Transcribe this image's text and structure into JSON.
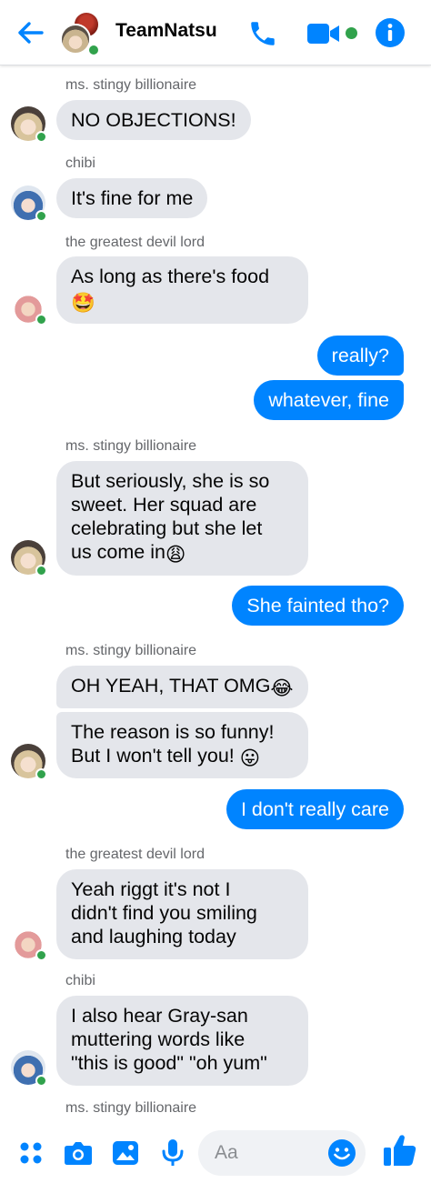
{
  "header": {
    "back_icon": "arrow-left-icon",
    "title": "TeamNatsu",
    "call_icon": "phone-icon",
    "video_icon": "video-camera-icon",
    "info_icon": "info-icon",
    "accent_color": "#0084ff",
    "online_color": "#31a24c"
  },
  "messages": {
    "s1": "ms. stingy billionaire",
    "m1": "NO OBJECTIONS!",
    "s2": "chibi",
    "m2": "It's fine for me",
    "s3": "the greatest devil lord",
    "m3_l1": "As long as there's food",
    "m3_emoji": "🤩",
    "m4": "really?",
    "m5": "whatever, fine",
    "s4": "ms. stingy billionaire",
    "m6_l1": "But seriously, she is so",
    "m6_l2": "sweet. Her squad are",
    "m6_l3": "celebrating but she let",
    "m6_l4": "us come in",
    "m6_emoji": "😩",
    "m7": "She fainted tho?",
    "s5": "ms. stingy billionaire",
    "m8": "OH YEAH, THAT OMG",
    "m8_emoji": "😂",
    "m9_l1": "The reason is so funny!",
    "m9_l2": "But I won't tell you! ",
    "m9_emoji": "😛",
    "m10": "I don't really care",
    "s6": "the greatest devil lord",
    "m11_l1": "Yeah riggt it's not I",
    "m11_l2": "didn't find you smiling",
    "m11_l3": "and laughing today",
    "s7": "chibi",
    "m12_l1": "I also hear Gray-san",
    "m12_l2": "muttering words like",
    "m12_l3": "\"this is good\" \"oh yum\"",
    "s8": "ms. stingy billionaire"
  },
  "composer": {
    "apps_icon": "four-dots-icon",
    "camera_icon": "camera-icon",
    "gallery_icon": "image-icon",
    "mic_icon": "microphone-icon",
    "placeholder": "Aa",
    "emoji_icon": "smiley-icon",
    "like_icon": "thumbs-up-icon"
  }
}
